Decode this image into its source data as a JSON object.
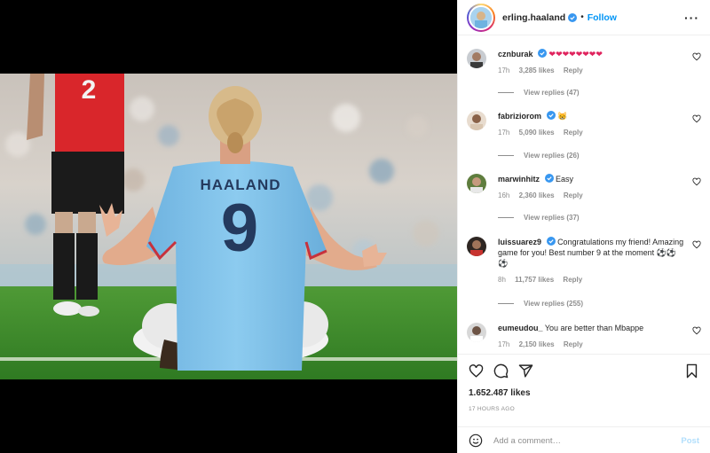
{
  "header": {
    "username": "erling.haaland",
    "separator": "•",
    "follow_label": "Follow",
    "more_icon": "more-options-icon"
  },
  "photo": {
    "jersey_name": "HAALAND",
    "jersey_number": "9",
    "opponent_number": "2"
  },
  "comments": [
    {
      "username": "cznburak",
      "text": "❤❤❤❤❤❤❤❤",
      "time": "17h",
      "likes": "3,285 likes",
      "reply": "Reply",
      "view_replies": "View replies (47)"
    },
    {
      "username": "fabriziorom",
      "text": "😸",
      "time": "17h",
      "likes": "5,090 likes",
      "reply": "Reply",
      "view_replies": "View replies (26)"
    },
    {
      "username": "marwinhitz",
      "text": "Easy",
      "time": "16h",
      "likes": "2,360 likes",
      "reply": "Reply",
      "view_replies": "View replies (37)"
    },
    {
      "username": "luissuarez9",
      "text": "Congratulations my friend! Amazing game for you! Best number 9 at the moment ⚽⚽⚽",
      "time": "8h",
      "likes": "11,757 likes",
      "reply": "Reply",
      "view_replies": "View replies (255)"
    },
    {
      "username": "eumeudou_",
      "text": "You are better than Mbappe",
      "time": "17h",
      "likes": "2,150 likes",
      "reply": "Reply",
      "view_replies": ""
    }
  ],
  "actions": {
    "like_icon": "heart-icon",
    "comment_icon": "comment-icon",
    "share_icon": "share-icon",
    "save_icon": "bookmark-icon",
    "likes_count": "1.652.487 likes",
    "timestamp": "17 HOURS AGO"
  },
  "add_comment": {
    "placeholder": "Add a comment…",
    "post_label": "Post"
  },
  "colors": {
    "accent": "#0095f6",
    "verified": "#3897f0",
    "jersey": "#7fc0ea"
  }
}
